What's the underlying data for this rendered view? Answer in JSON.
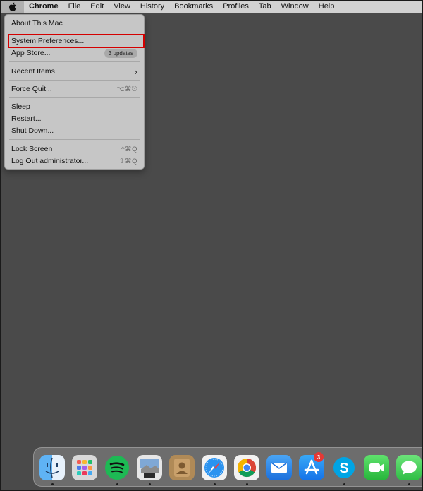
{
  "menubar": {
    "items": [
      "Chrome",
      "File",
      "Edit",
      "View",
      "History",
      "Bookmarks",
      "Profiles",
      "Tab",
      "Window",
      "Help"
    ]
  },
  "apple_menu": {
    "about": "About This Mac",
    "system_preferences": "System Preferences...",
    "app_store": "App Store...",
    "app_store_badge": "3 updates",
    "recent_items": "Recent Items",
    "force_quit": "Force Quit...",
    "force_quit_shortcut": "⌥⌘⎋",
    "sleep": "Sleep",
    "restart": "Restart...",
    "shut_down": "Shut Down...",
    "lock_screen": "Lock Screen",
    "lock_screen_shortcut": "^⌘Q",
    "log_out": "Log Out administrator...",
    "log_out_shortcut": "⇧⌘Q"
  },
  "dock": {
    "apps": [
      "finder-icon",
      "launchpad-icon",
      "spotify-icon",
      "preview-icon",
      "contacts-icon",
      "safari-icon",
      "chrome-icon",
      "mail-icon",
      "app-store-icon",
      "skype-icon",
      "facetime-icon",
      "messages-icon"
    ],
    "app_store_badge": "3"
  },
  "colors": {
    "desktop": "#4a4a4a",
    "highlight": "#d40000"
  }
}
